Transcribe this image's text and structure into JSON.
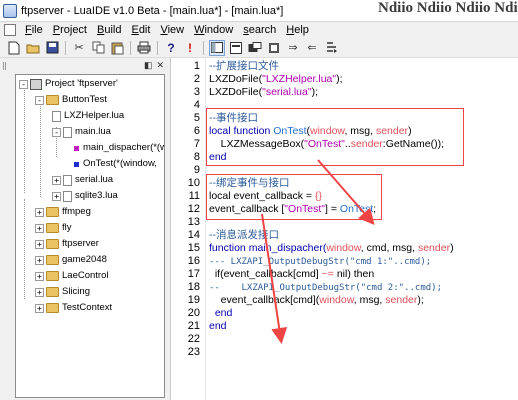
{
  "window": {
    "title": "ftpserver - LuaIDE v1.0 Beta - [main.lua*] - [main.lua*]",
    "background_text": "Ndiio  Ndiio  Ndiio  Ndiio  Nd"
  },
  "menu": [
    "File",
    "Project",
    "Build",
    "Edit",
    "View",
    "Window",
    "search",
    "Help"
  ],
  "toolbar": {
    "buttons": [
      "new-file",
      "open-folder",
      "save",
      "cut",
      "copy",
      "paste",
      "print",
      "help",
      "exclamation",
      "output-window",
      "file",
      "project",
      "module",
      "forward",
      "back",
      "step"
    ]
  },
  "tree": {
    "project": "Project 'ftpserver'",
    "items": [
      {
        "label": "ButtonTest",
        "type": "folder"
      },
      {
        "label": "LXZHelper.lua",
        "type": "file"
      },
      {
        "label": "main.lua",
        "type": "file"
      },
      {
        "label": "main_dispacher(*(w",
        "type": "func-m"
      },
      {
        "label": "OnTest(*(window,",
        "type": "func-b"
      },
      {
        "label": "serial.lua",
        "type": "file"
      },
      {
        "label": "sqlite3.lua",
        "type": "file"
      },
      {
        "label": "ffmpeg",
        "type": "folder"
      },
      {
        "label": "fly",
        "type": "folder"
      },
      {
        "label": "ftpserver",
        "type": "folder"
      },
      {
        "label": "game2048",
        "type": "folder"
      },
      {
        "label": "LaeControl",
        "type": "folder"
      },
      {
        "label": "Slicing",
        "type": "folder"
      },
      {
        "label": "TestContext",
        "type": "folder"
      }
    ]
  },
  "editor": {
    "line_numbers": [
      "1",
      "2",
      "3",
      "4",
      "5",
      "6",
      "7",
      "8",
      "9",
      "10",
      "11",
      "12",
      "13",
      "14",
      "15",
      "16",
      "17",
      "18",
      "19",
      "20",
      "21",
      "22",
      "23"
    ],
    "lines": {
      "l1": "--扩展接口文件",
      "l2a": "LXZDoFile(",
      "l2b": "\"LXZHelper.lua\"",
      "l2c": ");",
      "l3a": "LXZDoFile(",
      "l3b": "\"serial.lua\"",
      "l3c": ");",
      "l5": "--事件接口",
      "l6a": "local function ",
      "l6b": "OnTest",
      "l6c": "(",
      "l6d": "window",
      "l6e": ", msg, ",
      "l6f": "sender",
      "l6g": ")",
      "l7a": "    LXZMessageBox(",
      "l7b": "\"OnTest\"",
      "l7c": "..",
      "l7d": "sender",
      "l7e": ":GetName());",
      "l8": "end",
      "l10": "--绑定事件与接口",
      "l11a": "local event_callback = ",
      "l11b": "{}",
      "l12a": "event_callback [",
      "l12b": "\"OnTest\"",
      "l12c": "] = ",
      "l12d": "OnTest",
      "l12e": ";",
      "l14": "--消息派发接口",
      "l15a": "function main_dispacher(",
      "l15b": "window",
      "l15c": ", cmd, msg, ",
      "l15d": "sender",
      "l15e": ")",
      "l16": "--- LXZAPI_OutputDebugStr(\"cmd 1:\"..cmd);",
      "l17a": "  if(event_callback[cmd] ",
      "l17b": "~=",
      "l17c": " nil) then",
      "l18": "--    LXZAPI_OutputDebugStr(\"cmd 2:\"..cmd);",
      "l19a": "    event_callback[cmd](",
      "l19b": "window",
      "l19c": ", msg, ",
      "l19d": "sender",
      "l19e": ");",
      "l20": "  end",
      "l21": "end"
    }
  },
  "annotations": {
    "box_color": "#ee4444",
    "arrow_color": "#ee4444"
  }
}
